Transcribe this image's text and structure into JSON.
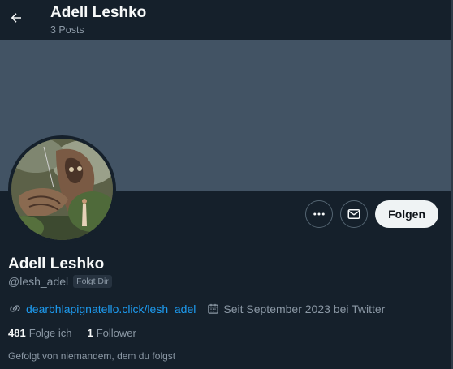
{
  "header": {
    "title": "Adell Leshko",
    "subtitle": "3 Posts",
    "back_icon": "arrow-left-icon"
  },
  "profile": {
    "name": "Adell Leshko",
    "handle": "@lesh_adel",
    "follows_you_badge": "Folgt Dir",
    "website": "dearbhlapignatello.click/lesh_adel",
    "joined": "Seit September 2023 bei Twitter",
    "following_count": "481",
    "following_label": "Folge ich",
    "followers_count": "1",
    "followers_label": "Follower",
    "followed_by_text": "Gefolgt von niemandem, dem du folgst"
  },
  "actions": {
    "more_icon": "more-icon",
    "message_icon": "envelope-icon",
    "follow_label": "Folgen"
  },
  "colors": {
    "background": "#15202b",
    "banner": "#425364",
    "link": "#1d9bf0",
    "secondary_text": "#8b98a5",
    "follow_button_bg": "#eff3f4"
  }
}
